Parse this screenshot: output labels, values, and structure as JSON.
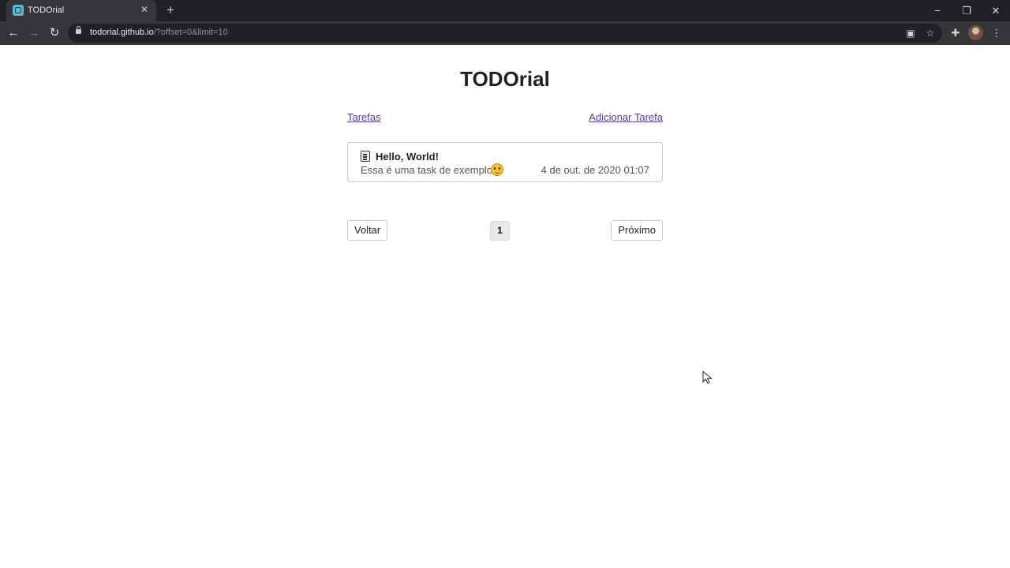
{
  "browser": {
    "tab_title": "TODOrial",
    "url_host": "todorial.github.io",
    "url_path": "/?offset=0&limit=10"
  },
  "app": {
    "title": "TODOrial"
  },
  "nav": {
    "tasks_link": "Tarefas",
    "add_task_link": "Adicionar Tarefa"
  },
  "tasks": [
    {
      "title": "Hello, World!",
      "description": "Essa é uma task de exemplo.",
      "date": "4 de out. de 2020 01:07"
    }
  ],
  "pagination": {
    "prev_label": "Voltar",
    "current_page": "1",
    "next_label": "Próximo"
  }
}
